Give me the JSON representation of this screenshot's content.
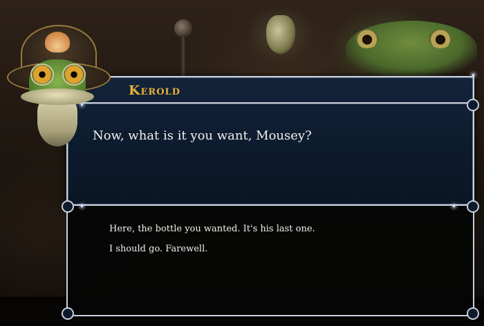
{
  "dialog": {
    "speaker_name": "Kerold",
    "line": "Now, what is it you want, Mousey?"
  },
  "choices": [
    {
      "label": "Here, the bottle you wanted. It's his last one."
    },
    {
      "label": "I should go. Farewell."
    }
  ],
  "colors": {
    "speaker_name": "#e5b23a",
    "dialog_background": "#0c1a2c",
    "frame": "#c9d0dc",
    "text": "#f1f1ee"
  },
  "portrait": {
    "icon": "frog-pirate-portrait-icon"
  }
}
